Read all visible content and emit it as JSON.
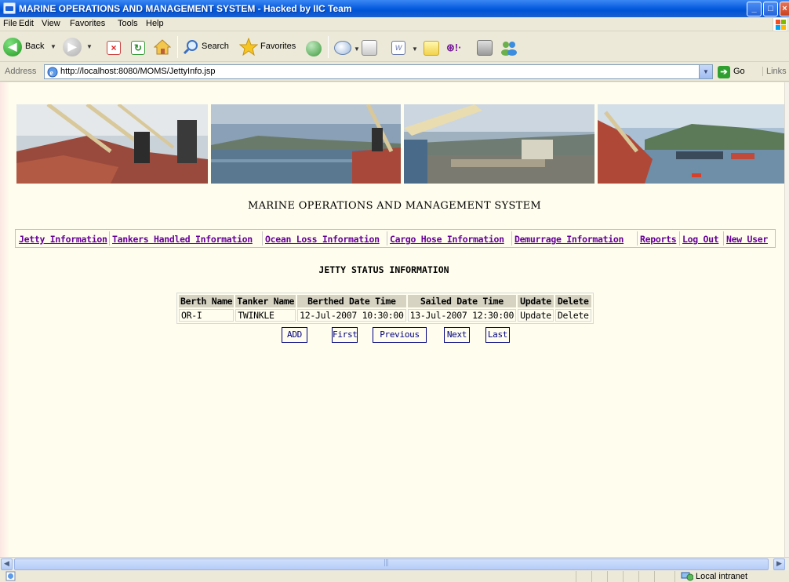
{
  "window": {
    "title": "MARINE OPERATIONS AND MANAGEMENT SYSTEM - Hacked by IIC Team"
  },
  "menu": [
    "File",
    "Edit",
    "View",
    "Favorites",
    "Tools",
    "Help"
  ],
  "toolbar": {
    "back_label": "Back",
    "search_label": "Search",
    "favorites_label": "Favorites"
  },
  "address": {
    "label": "Address",
    "url": "http://localhost:8080/MOMS/JettyInfo.jsp",
    "go_label": "Go",
    "links_label": "Links"
  },
  "page": {
    "system_title": "MARINE OPERATIONS AND MANAGEMENT SYSTEM",
    "nav_links": [
      "Jetty Information",
      "Tankers Handled Information",
      "Ocean Loss Information",
      "Cargo Hose Information",
      "Demurrage Information",
      "Reports",
      "Log Out",
      "New User"
    ],
    "section_title": "JETTY STATUS INFORMATION",
    "table": {
      "headers": [
        "Berth Name",
        "Tanker Name",
        "Berthed Date Time",
        "Sailed Date Time",
        "Update",
        "Delete"
      ],
      "rows": [
        [
          "OR-I",
          "TWINKLE",
          "12-Jul-2007 10:30:00",
          "13-Jul-2007 12:30:00",
          "Update",
          "Delete"
        ]
      ]
    },
    "buttons": {
      "add": "ADD",
      "first": "First",
      "previous": "Previous",
      "next": "Next",
      "last": "Last"
    }
  },
  "status": {
    "zone": "Local intranet"
  },
  "colors": {
    "visited_link": "#660099",
    "button_border": "#000080",
    "page_background": "#fffdee",
    "titlebar_blue": "#0053d6"
  }
}
